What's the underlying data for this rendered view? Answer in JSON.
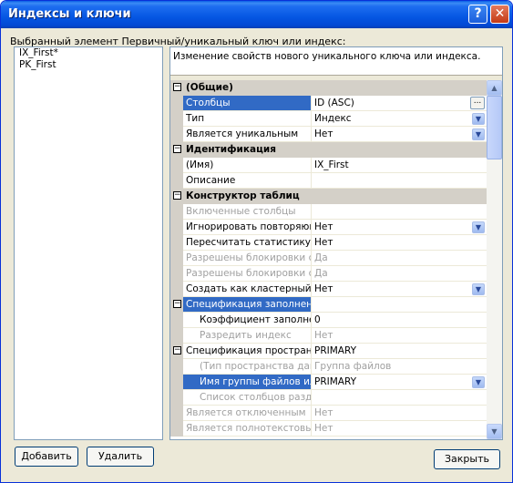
{
  "window": {
    "title": "Индексы и ключи",
    "help_glyph": "?",
    "close_glyph": "✕"
  },
  "description_label": "Выбранный элемент Первичный/уникальный ключ или индекс:",
  "left_list": {
    "items": [
      "IX_First*",
      "PK_First"
    ]
  },
  "info_text": "Изменение свойств нового уникального ключа или индекса.",
  "grid": {
    "toggle_glyph": "−",
    "dropdown_glyph": "▼",
    "ellipsis_glyph": "...",
    "cat_general": "(Общие)",
    "columns_name": "Столбцы",
    "columns_value": "ID (ASC)",
    "type_name": "Тип",
    "type_value": "Индекс",
    "unique_name": "Является уникальным",
    "unique_value": "Нет",
    "cat_ident": "Идентификация",
    "name_name": "(Имя)",
    "name_value": "IX_First",
    "desc_name": "Описание",
    "desc_value": "",
    "cat_designer": "Конструктор таблиц",
    "incl_name": "Включенные столбцы",
    "incl_value": "",
    "ignore_name": "Игнорировать повторяющи",
    "ignore_value": "Нет",
    "recompute_name": "Пересчитать статистику",
    "recompute_value": "Нет",
    "rowlocks_name": "Разрешены блокировки стр",
    "rowlocks_value": "Да",
    "pagelocks_name": "Разрешены блокировки стр",
    "pagelocks_value": "Да",
    "clustered_name": "Создать как кластерный",
    "clustered_value": "Нет",
    "fillspec_name": "Спецификация заполнения",
    "fillspec_value": "",
    "fillfactor_name": "Коэффициент заполнен",
    "fillfactor_value": "0",
    "padindex_name": "Разредить индекс",
    "padindex_value": "Нет",
    "dataspace_name": "Спецификация пространст",
    "dataspace_value": "PRIMARY",
    "dstype_name": "(Тип пространства данн",
    "dstype_value": "Группа файлов",
    "fgname_name": "Имя группы файлов или",
    "fgname_value": "PRIMARY",
    "partcols_name": "Список столбцов раздел",
    "partcols_value": "",
    "disabled_name": "Является отключенным",
    "disabled_value": "Нет",
    "fulltext_name": "Является полнотекстовым",
    "fulltext_value": "Нет"
  },
  "scrollbar": {
    "up_glyph": "▲",
    "down_glyph": "▼"
  },
  "buttons": {
    "add": "Добавить",
    "delete": "Удалить",
    "close": "Закрыть"
  }
}
